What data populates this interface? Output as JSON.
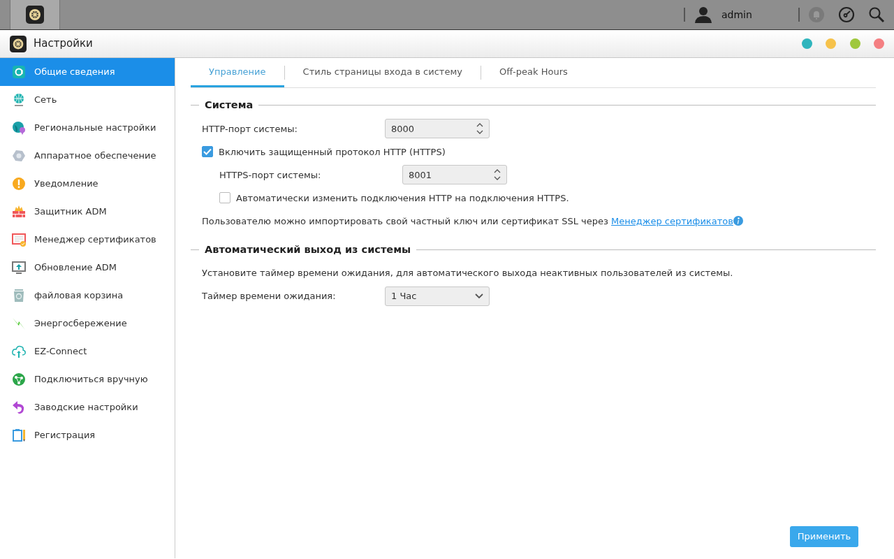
{
  "taskbar": {
    "user": "admin"
  },
  "window": {
    "title": "Настройки"
  },
  "sidebar": {
    "items": [
      {
        "label": "Общие сведения",
        "selected": true
      },
      {
        "label": "Сеть",
        "selected": false
      },
      {
        "label": "Региональные настройки",
        "selected": false
      },
      {
        "label": "Аппаратное обеспечение",
        "selected": false
      },
      {
        "label": "Уведомление",
        "selected": false
      },
      {
        "label": "Защитник ADM",
        "selected": false
      },
      {
        "label": "Менеджер сертификатов",
        "selected": false
      },
      {
        "label": "Обновление ADM",
        "selected": false
      },
      {
        "label": "файловая корзина",
        "selected": false
      },
      {
        "label": "Энергосбережение",
        "selected": false
      },
      {
        "label": "EZ-Connect",
        "selected": false
      },
      {
        "label": "Подключиться вручную",
        "selected": false
      },
      {
        "label": "Заводские настройки",
        "selected": false
      },
      {
        "label": "Регистрация",
        "selected": false
      }
    ]
  },
  "tabs": [
    {
      "label": "Управление",
      "selected": true
    },
    {
      "label": "Стиль страницы входа в систему",
      "selected": false
    },
    {
      "label": "Off-peak Hours",
      "selected": false
    }
  ],
  "sections": [
    {
      "title": "Система",
      "rows": [
        {
          "kind": "number",
          "label": "HTTP-порт системы:",
          "value": "8000"
        },
        {
          "kind": "checkbox",
          "label": "Включить защищенный протокол HTTP (HTTPS)",
          "checked": true,
          "children": [
            {
              "kind": "number",
              "label": "HTTPS-порт системы:",
              "value": "8001"
            },
            {
              "kind": "checkbox",
              "label": "Автоматически изменить подключения HTTP на подключения HTTPS.",
              "checked": false
            }
          ]
        },
        {
          "kind": "note",
          "text": "Пользователю можно импортировать свой частный ключ или сертификат SSL через",
          "link": "Менеджер сертификатов"
        }
      ]
    },
    {
      "title": "Автоматический выход из системы",
      "rows": [
        {
          "kind": "text",
          "text": "Установите таймер времени ожидания, для автоматического выхода неактивных пользователей из системы."
        },
        {
          "kind": "select",
          "label": "Таймер времени ожидания:",
          "value": "1 Час"
        }
      ]
    }
  ],
  "apply_button": "Применить"
}
